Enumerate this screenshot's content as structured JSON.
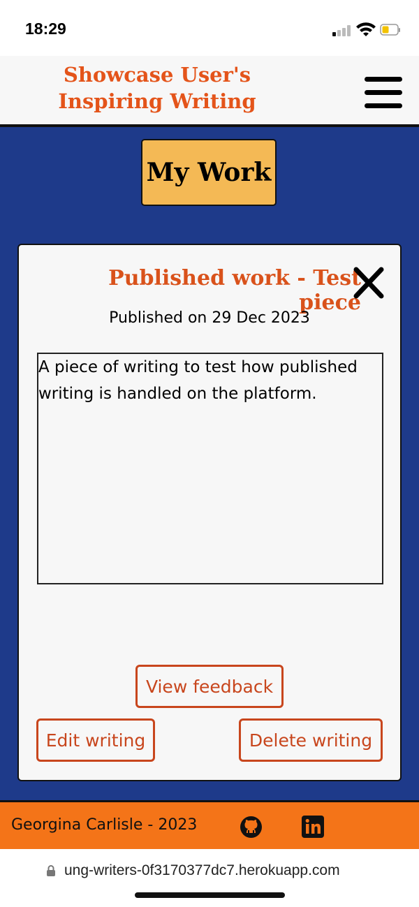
{
  "status_bar": {
    "time": "18:29",
    "icons": [
      "signal-icon",
      "wifi-icon",
      "battery-icon"
    ]
  },
  "header": {
    "brand": "Showcase User's Inspiring Writing",
    "menu_icon": "hamburger-menu-icon"
  },
  "main": {
    "my_work_label": "My Work"
  },
  "card": {
    "title": "Published work - Test piece",
    "close_icon": "close-icon",
    "published_date": "Published on 29 Dec 2023",
    "content": "A piece of writing to test how published writing is handled on the platform.",
    "buttons": {
      "view_feedback": "View feedback",
      "edit_writing": "Edit writing",
      "delete_writing": "Delete writing"
    }
  },
  "footer": {
    "credit": "Georgina Carlisle - 2023",
    "icons": [
      "github-icon",
      "linkedin-icon"
    ]
  },
  "browser": {
    "url": "ung-writers-0f3170377dc7.herokuapp.com"
  },
  "colors": {
    "brand_orange": "#e4541a",
    "main_blue": "#1e3a8a",
    "button_yellow": "#f4b955",
    "footer_orange": "#f47418",
    "action_red": "#c8461d"
  }
}
